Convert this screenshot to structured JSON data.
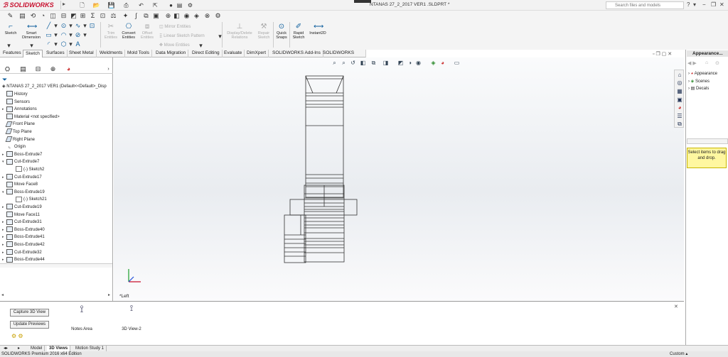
{
  "app": {
    "logo": "SOLIDWORKS",
    "document_title": "NTANAS 27_2_2017 VER1 .SLDPRT *"
  },
  "search": {
    "placeholder": "Search files and models"
  },
  "help_icon": "?",
  "commands": {
    "sketch": "Sketch",
    "smart_dimension": "Smart Dimension",
    "trim_entities": "Trim Entities",
    "convert_entities": "Convert Entities",
    "offset_entities": "Offset Entities",
    "mirror_entities": "Mirror Entities",
    "linear_sketch_pattern": "Linear Sketch Pattern",
    "move_entities": "Move Entities",
    "display_delete_relations": "Display/Delete Relations",
    "repair_sketch": "Repair Sketch",
    "quick_snaps": "Quick Snaps",
    "rapid_sketch": "Rapid Sketch",
    "instant2d": "Instant2D"
  },
  "cmd_tabs": [
    "Features",
    "Sketch",
    "Surfaces",
    "Sheet Metal",
    "Weldments",
    "Mold Tools",
    "Data Migration",
    "Direct Editing",
    "Evaluate",
    "DimXpert",
    "SOLIDWORKS Add-Ins",
    "SOLIDWORKS MBD"
  ],
  "tree": {
    "root": "NTANAS 27_2_2017 VER1  (Default<<Default>_Disp",
    "items": [
      {
        "label": "History",
        "icon": "history-icon"
      },
      {
        "label": "Sensors",
        "icon": "sensors-icon"
      },
      {
        "label": "Annotations",
        "icon": "annotations-icon"
      },
      {
        "label": "Material <not specified>",
        "icon": "material-icon"
      },
      {
        "label": "Front Plane",
        "icon": "plane-icon"
      },
      {
        "label": "Top Plane",
        "icon": "plane-icon"
      },
      {
        "label": "Right Plane",
        "icon": "plane-icon"
      },
      {
        "label": "Origin",
        "icon": "origin-icon"
      },
      {
        "label": "Boss-Extrude7",
        "icon": "boss-extrude-icon"
      },
      {
        "label": "Cut-Extrude7",
        "icon": "cut-extrude-icon"
      },
      {
        "label": "(-) Sketch2",
        "icon": "sketch-icon"
      },
      {
        "label": "Cut-Extrude17",
        "icon": "cut-extrude-icon"
      },
      {
        "label": "Move Face8",
        "icon": "move-face-icon"
      },
      {
        "label": "Boss-Extrude19",
        "icon": "boss-extrude-icon"
      },
      {
        "label": "(-) Sketch21",
        "icon": "sketch-icon"
      },
      {
        "label": "Cut-Extrude19",
        "icon": "cut-extrude-icon"
      },
      {
        "label": "Move Face11",
        "icon": "move-face-icon"
      },
      {
        "label": "Cut-Extrude31",
        "icon": "cut-extrude-icon"
      },
      {
        "label": "Boss-Extrude40",
        "icon": "boss-extrude-icon"
      },
      {
        "label": "Boss-Extrude41",
        "icon": "boss-extrude-icon"
      },
      {
        "label": "Boss-Extrude42",
        "icon": "boss-extrude-icon"
      },
      {
        "label": "Cut-Extrude32",
        "icon": "cut-extrude-icon"
      },
      {
        "label": "Boss-Extrude44",
        "icon": "boss-extrude-icon"
      }
    ]
  },
  "viewport": {
    "view_label": "*Left"
  },
  "taskpane": {
    "title": "Appearance...",
    "items": [
      "Appearance",
      "Scenes",
      "Decals"
    ],
    "note": "Select items to drag and drop."
  },
  "bottom": {
    "capture_3d_view": "Capture 3D View",
    "update_previews": "Update Previews",
    "thumbs": [
      "Notes Area",
      "3D View-2"
    ]
  },
  "bottom_tabs": [
    "Model",
    "3D Views",
    "Motion Study 1"
  ],
  "status": {
    "edition": "SOLIDWORKS Premium 2016 x64 Edition",
    "units": "Custom"
  },
  "colors": {
    "brand_red": "#c8102e",
    "note_bg": "#fff7a0"
  }
}
